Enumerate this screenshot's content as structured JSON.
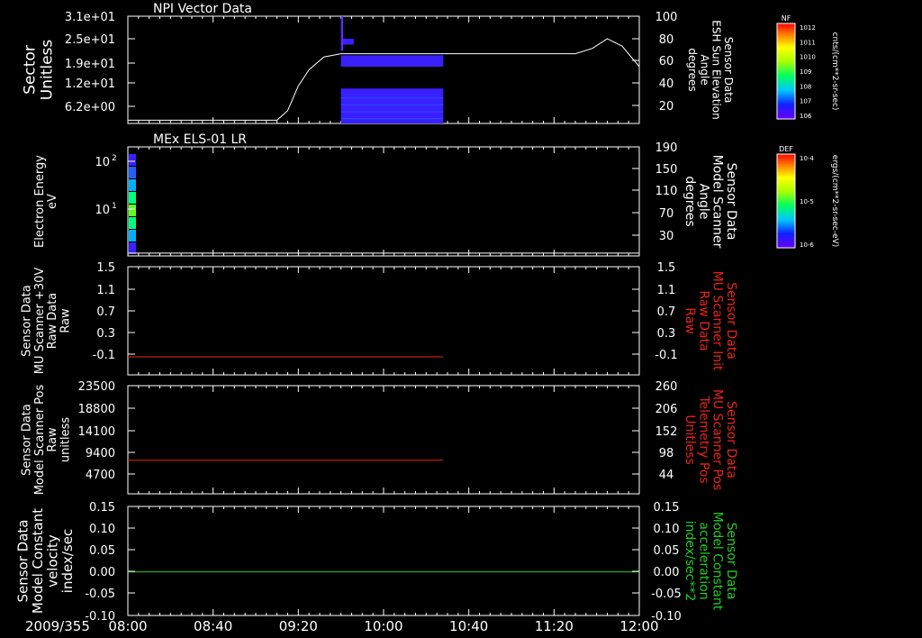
{
  "date_label": "2009/355",
  "x_axis": {
    "tick_labels": [
      "08:00",
      "08:40",
      "09:20",
      "10:00",
      "10:40",
      "11:20",
      "12:00"
    ],
    "range_minutes": [
      0,
      240
    ]
  },
  "colors": {
    "background": "#000000",
    "axes": "#ffffff",
    "red_trace": "#e8231c",
    "green_trace": "#22cc22",
    "spectrogram_blue": "#3a1fff"
  },
  "chart_data": [
    {
      "type": "heatmap",
      "title": "NPI Vector Data",
      "ylabel": "Sector\nUnitless",
      "yticks_left": [
        "3.1e+01",
        "2.5e+01",
        "1.9e+01",
        "1.2e+01",
        "6.2e+00"
      ],
      "ylim": [
        0,
        31
      ],
      "right_axis": {
        "label": "Sensor Data\nESH Sun Elevation\nAngle\ndegrees",
        "ticks": [
          "100",
          "80",
          "60",
          "40",
          "20"
        ],
        "ylim": [
          0,
          100
        ]
      },
      "line_series": {
        "x_minutes": [
          0,
          70,
          75,
          80,
          85,
          92,
          100,
          120,
          180,
          210,
          218,
          225,
          232,
          240
        ],
        "y_degrees": [
          3,
          3,
          12,
          35,
          50,
          62,
          65,
          65,
          65,
          65,
          70,
          79,
          72,
          53
        ]
      },
      "colorbar": {
        "label": "NF",
        "units": "cnts/(cm**2-sr-sec)",
        "ticks": [
          "10^12",
          "10^11",
          "10^10",
          "10^9",
          "10^8",
          "10^7",
          "10^6"
        ]
      }
    },
    {
      "type": "heatmap",
      "title": "MEx ELS-01 LR",
      "ylabel": "Electron Energy\neV",
      "yticks_left": [
        "10^2",
        "10^1"
      ],
      "ylim_log10": [
        0,
        2.3
      ],
      "right_axis": {
        "label": "Sensor Data\nModel Scanner\nAngle\ndegrees",
        "ticks": [
          "190",
          "150",
          "110",
          "70",
          "30"
        ],
        "ylim": [
          0,
          190
        ]
      },
      "line_series": {
        "x_minutes": [
          0,
          240
        ],
        "y_degrees": [
          5,
          5
        ]
      },
      "colorbar": {
        "label": "DEF",
        "units": "ergs/(cm**2-sr-sec-eV)",
        "ticks": [
          "10^-4",
          "10^-5",
          "10^-6"
        ]
      }
    },
    {
      "type": "line",
      "ylabel": "Sensor Data\nMU Scanner +30V\nRaw Data\nRaw",
      "yticks_left": [
        "1.5",
        "1.1",
        "0.7",
        "0.3",
        "-0.1"
      ],
      "ylim": [
        -0.3,
        1.5
      ],
      "right_axis": {
        "label": "Sensor Data\nMU Scanner Init\nRaw Data\nRaw",
        "ticks": [
          "1.5",
          "1.1",
          "0.7",
          "0.3",
          "-0.1"
        ],
        "ylim": [
          -0.3,
          1.5
        ]
      },
      "series": [
        {
          "x_minutes": [
            0,
            148
          ],
          "values": [
            0,
            0
          ]
        }
      ]
    },
    {
      "type": "line",
      "ylabel": "Sensor Data\nModel Scanner Pos\nRaw\nunitless",
      "yticks_left": [
        "23500",
        "18800",
        "14100",
        "9400",
        "4700"
      ],
      "ylim": [
        0,
        23500
      ],
      "right_axis": {
        "label": "Sensor Data\nMU Scanner Pos\nTelemetry Pos\nUnitless",
        "ticks": [
          "260",
          "206",
          "152",
          "98",
          "44"
        ],
        "ylim": [
          0,
          260
        ]
      },
      "series": [
        {
          "x_minutes": [
            0,
            148
          ],
          "values": [
            7300,
            7300
          ]
        }
      ]
    },
    {
      "type": "line",
      "ylabel": "Sensor Data\nModel Constant\nvelocity\nindex/sec",
      "yticks_left": [
        "0.15",
        "0.10",
        "0.05",
        "0.00",
        "-0.05",
        "-0.10"
      ],
      "ylim": [
        -0.1,
        0.15
      ],
      "right_axis": {
        "label": "Sensor Data\nModel Constant\nacceleration\nindex/sec**2",
        "ticks": [
          "0.15",
          "0.10",
          "0.05",
          "0.00",
          "-0.05",
          "-0.10"
        ],
        "ylim": [
          -0.1,
          0.15
        ]
      },
      "series": [
        {
          "x_minutes": [
            0,
            240
          ],
          "values": [
            0,
            0
          ]
        }
      ]
    }
  ]
}
